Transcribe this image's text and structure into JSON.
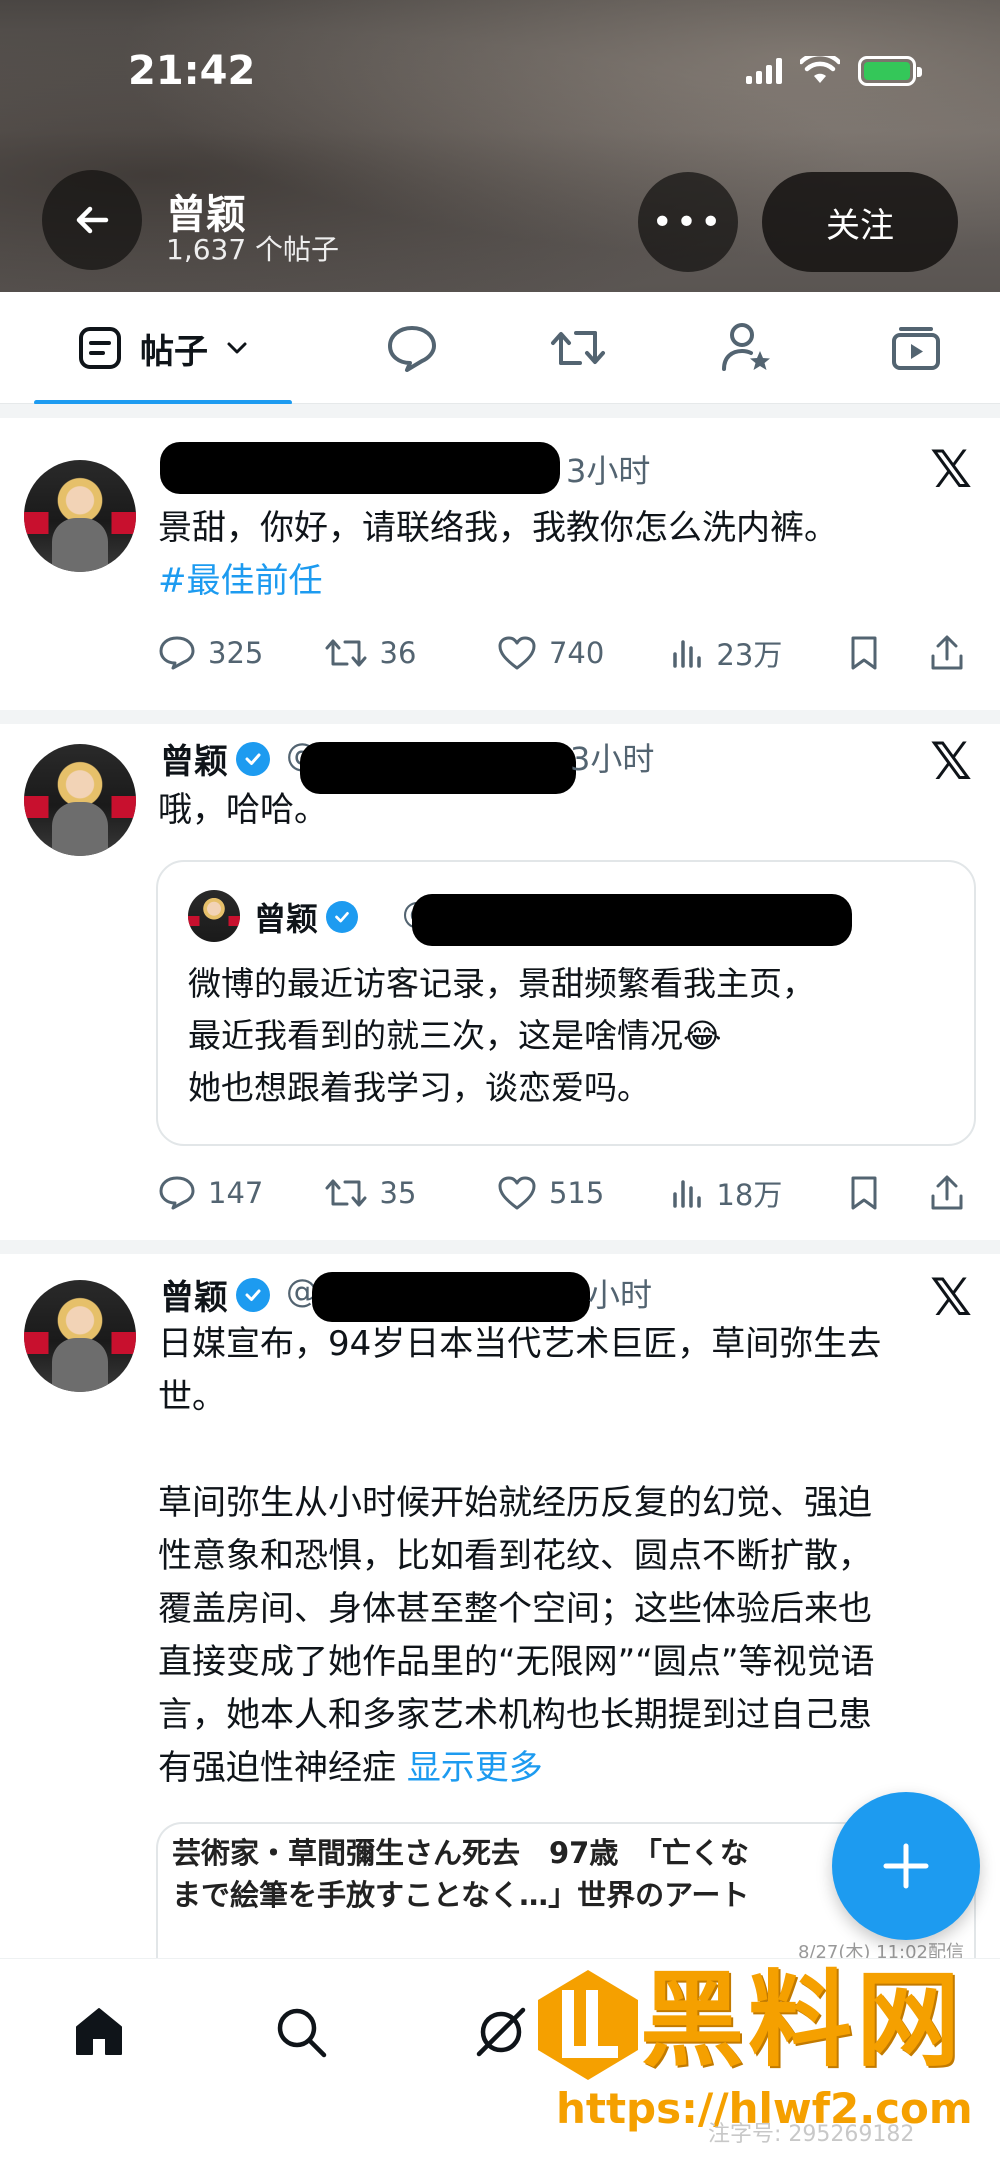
{
  "status_bar": {
    "time": "21:42"
  },
  "profile": {
    "name": "曾颖",
    "post_count": "1,637 个帖子",
    "follow_label": "关注",
    "more_label": "•••"
  },
  "tabs": {
    "posts_label": "帖子"
  },
  "posts": [
    {
      "time": "3小时",
      "text": "景甜，你好，请联络我，我教你怎么洗内裤。",
      "hashtag": "#最佳前任",
      "stats": {
        "replies": "325",
        "reposts": "36",
        "likes": "740",
        "views": "23万"
      }
    },
    {
      "name": "曾颖",
      "handle": "@",
      "time": "3小时",
      "text": "哦，哈哈。",
      "quote": {
        "name": "曾颖",
        "handle": "@",
        "text_lines": [
          "微博的最近访客记录，景甜频繁看我主页，",
          "最近我看到的就三次，这是啥情况😂",
          "她也想跟着我学习，谈恋爱吗。"
        ]
      },
      "stats": {
        "replies": "147",
        "reposts": "35",
        "likes": "515",
        "views": "18万"
      }
    },
    {
      "name": "曾颖",
      "handle": "@",
      "time": "小时",
      "text_lines": [
        "日媒宣布，94岁日本当代艺术巨匠，草间弥生去",
        "世。",
        "",
        "草间弥生从小时候开始就经历反复的幻觉、强迫",
        "性意象和恐惧，比如看到花纹、圆点不断扩散，",
        "覆盖房间、身体甚至整个空间；这些体验后来也",
        "直接变成了她作品里的“无限网”“圆点”等视觉语",
        "言，她本人和多家艺术机构也长期提到过自己患",
        "有强迫性神经症 "
      ],
      "show_more": "显示更多",
      "link_card": {
        "line1": "芸術家・草間彌生さん死去　97歳　「亡くな",
        "line2": "まで絵筆を手放すことなく…」世界のアート",
        "date": "8/27(木) 11:02配信"
      }
    }
  ],
  "watermark": {
    "title": "黑料网",
    "url": "https://hlwf2.com",
    "id": "注字号: 295269182"
  },
  "colors": {
    "accent": "#1d9bf0",
    "text": "#0f1419",
    "muted": "#536471",
    "watermark": "#f5a000"
  }
}
